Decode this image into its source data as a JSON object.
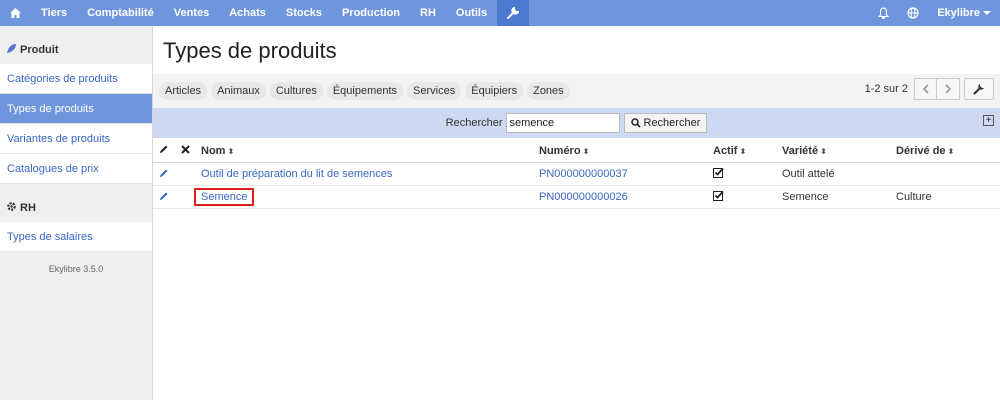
{
  "topnav": {
    "items": [
      "Tiers",
      "Comptabilité",
      "Ventes",
      "Achats",
      "Stocks",
      "Production",
      "RH",
      "Outils"
    ],
    "user": "Ekylibre"
  },
  "sidebar": {
    "sections": [
      {
        "title": "Produit",
        "items": [
          "Catégories de produits",
          "Types de produits",
          "Variantes de produits",
          "Catalogues de prix"
        ],
        "active_index": 1
      },
      {
        "title": "RH",
        "items": [
          "Types de salaires"
        ]
      }
    ],
    "version": "Ekylibre 3.5.0"
  },
  "main": {
    "title": "Types de produits",
    "tabs": [
      "Articles",
      "Animaux",
      "Cultures",
      "Équipements",
      "Services",
      "Équipiers",
      "Zones"
    ],
    "pagination": "1-2 sur 2",
    "search": {
      "label": "Rechercher",
      "value": "semence",
      "button": "Rechercher"
    },
    "table": {
      "headers": {
        "nom": "Nom",
        "numero": "Numéro",
        "actif": "Actif",
        "variete": "Variété",
        "derive": "Dérivé de"
      },
      "rows": [
        {
          "nom": "Outil de préparation du lit de semences",
          "numero": "PN000000000037",
          "actif": true,
          "variete": "Outil attelé",
          "derive": ""
        },
        {
          "nom": "Semence",
          "numero": "PN000000000026",
          "actif": true,
          "variete": "Semence",
          "derive": "Culture"
        }
      ]
    }
  },
  "colors": {
    "topbar": "#6f96dc",
    "active": "#4d7ad0",
    "link": "#3a66c4",
    "searchbar": "#cdd9f0",
    "highlight": "#e02020"
  }
}
